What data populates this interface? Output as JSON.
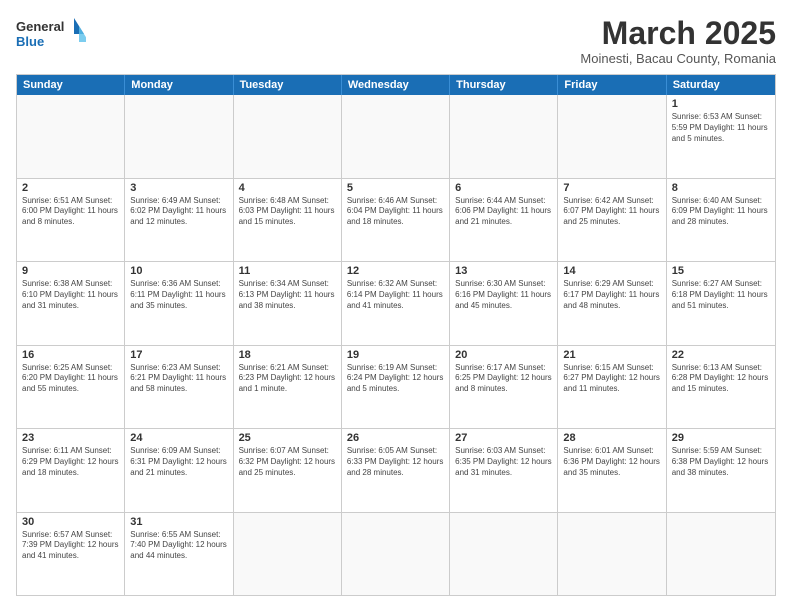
{
  "header": {
    "logo_general": "General",
    "logo_blue": "Blue",
    "month_title": "March 2025",
    "subtitle": "Moinesti, Bacau County, Romania"
  },
  "weekdays": [
    "Sunday",
    "Monday",
    "Tuesday",
    "Wednesday",
    "Thursday",
    "Friday",
    "Saturday"
  ],
  "weeks": [
    [
      {
        "day": "",
        "info": ""
      },
      {
        "day": "",
        "info": ""
      },
      {
        "day": "",
        "info": ""
      },
      {
        "day": "",
        "info": ""
      },
      {
        "day": "",
        "info": ""
      },
      {
        "day": "",
        "info": ""
      },
      {
        "day": "1",
        "info": "Sunrise: 6:53 AM\nSunset: 5:59 PM\nDaylight: 11 hours and 5 minutes."
      }
    ],
    [
      {
        "day": "2",
        "info": "Sunrise: 6:51 AM\nSunset: 6:00 PM\nDaylight: 11 hours and 8 minutes."
      },
      {
        "day": "3",
        "info": "Sunrise: 6:49 AM\nSunset: 6:02 PM\nDaylight: 11 hours and 12 minutes."
      },
      {
        "day": "4",
        "info": "Sunrise: 6:48 AM\nSunset: 6:03 PM\nDaylight: 11 hours and 15 minutes."
      },
      {
        "day": "5",
        "info": "Sunrise: 6:46 AM\nSunset: 6:04 PM\nDaylight: 11 hours and 18 minutes."
      },
      {
        "day": "6",
        "info": "Sunrise: 6:44 AM\nSunset: 6:06 PM\nDaylight: 11 hours and 21 minutes."
      },
      {
        "day": "7",
        "info": "Sunrise: 6:42 AM\nSunset: 6:07 PM\nDaylight: 11 hours and 25 minutes."
      },
      {
        "day": "8",
        "info": "Sunrise: 6:40 AM\nSunset: 6:09 PM\nDaylight: 11 hours and 28 minutes."
      }
    ],
    [
      {
        "day": "9",
        "info": "Sunrise: 6:38 AM\nSunset: 6:10 PM\nDaylight: 11 hours and 31 minutes."
      },
      {
        "day": "10",
        "info": "Sunrise: 6:36 AM\nSunset: 6:11 PM\nDaylight: 11 hours and 35 minutes."
      },
      {
        "day": "11",
        "info": "Sunrise: 6:34 AM\nSunset: 6:13 PM\nDaylight: 11 hours and 38 minutes."
      },
      {
        "day": "12",
        "info": "Sunrise: 6:32 AM\nSunset: 6:14 PM\nDaylight: 11 hours and 41 minutes."
      },
      {
        "day": "13",
        "info": "Sunrise: 6:30 AM\nSunset: 6:16 PM\nDaylight: 11 hours and 45 minutes."
      },
      {
        "day": "14",
        "info": "Sunrise: 6:29 AM\nSunset: 6:17 PM\nDaylight: 11 hours and 48 minutes."
      },
      {
        "day": "15",
        "info": "Sunrise: 6:27 AM\nSunset: 6:18 PM\nDaylight: 11 hours and 51 minutes."
      }
    ],
    [
      {
        "day": "16",
        "info": "Sunrise: 6:25 AM\nSunset: 6:20 PM\nDaylight: 11 hours and 55 minutes."
      },
      {
        "day": "17",
        "info": "Sunrise: 6:23 AM\nSunset: 6:21 PM\nDaylight: 11 hours and 58 minutes."
      },
      {
        "day": "18",
        "info": "Sunrise: 6:21 AM\nSunset: 6:23 PM\nDaylight: 12 hours and 1 minute."
      },
      {
        "day": "19",
        "info": "Sunrise: 6:19 AM\nSunset: 6:24 PM\nDaylight: 12 hours and 5 minutes."
      },
      {
        "day": "20",
        "info": "Sunrise: 6:17 AM\nSunset: 6:25 PM\nDaylight: 12 hours and 8 minutes."
      },
      {
        "day": "21",
        "info": "Sunrise: 6:15 AM\nSunset: 6:27 PM\nDaylight: 12 hours and 11 minutes."
      },
      {
        "day": "22",
        "info": "Sunrise: 6:13 AM\nSunset: 6:28 PM\nDaylight: 12 hours and 15 minutes."
      }
    ],
    [
      {
        "day": "23",
        "info": "Sunrise: 6:11 AM\nSunset: 6:29 PM\nDaylight: 12 hours and 18 minutes."
      },
      {
        "day": "24",
        "info": "Sunrise: 6:09 AM\nSunset: 6:31 PM\nDaylight: 12 hours and 21 minutes."
      },
      {
        "day": "25",
        "info": "Sunrise: 6:07 AM\nSunset: 6:32 PM\nDaylight: 12 hours and 25 minutes."
      },
      {
        "day": "26",
        "info": "Sunrise: 6:05 AM\nSunset: 6:33 PM\nDaylight: 12 hours and 28 minutes."
      },
      {
        "day": "27",
        "info": "Sunrise: 6:03 AM\nSunset: 6:35 PM\nDaylight: 12 hours and 31 minutes."
      },
      {
        "day": "28",
        "info": "Sunrise: 6:01 AM\nSunset: 6:36 PM\nDaylight: 12 hours and 35 minutes."
      },
      {
        "day": "29",
        "info": "Sunrise: 5:59 AM\nSunset: 6:38 PM\nDaylight: 12 hours and 38 minutes."
      }
    ],
    [
      {
        "day": "30",
        "info": "Sunrise: 6:57 AM\nSunset: 7:39 PM\nDaylight: 12 hours and 41 minutes."
      },
      {
        "day": "31",
        "info": "Sunrise: 6:55 AM\nSunset: 7:40 PM\nDaylight: 12 hours and 44 minutes."
      },
      {
        "day": "",
        "info": ""
      },
      {
        "day": "",
        "info": ""
      },
      {
        "day": "",
        "info": ""
      },
      {
        "day": "",
        "info": ""
      },
      {
        "day": "",
        "info": ""
      }
    ]
  ]
}
